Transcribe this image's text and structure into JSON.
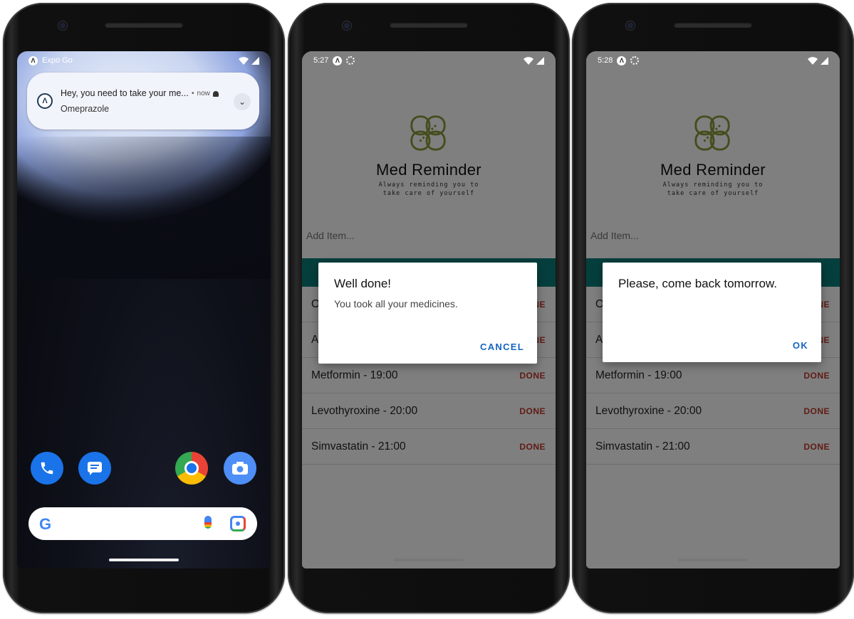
{
  "phone1": {
    "status": {
      "app_name": "Expo Go"
    },
    "notification": {
      "title": "Hey, you need to take your me...",
      "time": "now",
      "body": "Omeprazole"
    },
    "dock": {
      "apps": [
        "phone-icon",
        "messages-icon",
        "chrome-icon",
        "camera-icon"
      ]
    },
    "search": {
      "logo": "G"
    }
  },
  "phone2": {
    "status": {
      "time": "5:27"
    },
    "app": {
      "title": "Med Reminder",
      "tagline_line1": "Always reminding you to",
      "tagline_line2": "take care of yourself",
      "add_placeholder": "Add Item..."
    },
    "items": [
      {
        "label": "O",
        "action": "DONE"
      },
      {
        "label": "A",
        "action": "DONE"
      },
      {
        "label": "Metformin - 19:00",
        "action": "DONE"
      },
      {
        "label": "Levothyroxine - 20:00",
        "action": "DONE"
      },
      {
        "label": "Simvastatin - 21:00",
        "action": "DONE"
      }
    ],
    "dialog": {
      "title": "Well done!",
      "message": "You took all your medicines.",
      "button": "CANCEL"
    }
  },
  "phone3": {
    "status": {
      "time": "5:28"
    },
    "app": {
      "title": "Med Reminder",
      "tagline_line1": "Always reminding you to",
      "tagline_line2": "take care of yourself",
      "add_placeholder": "Add Item..."
    },
    "items": [
      {
        "label": "O",
        "action": "DONE"
      },
      {
        "label": "A",
        "action": "DONE"
      },
      {
        "label": "Metformin - 19:00",
        "action": "DONE"
      },
      {
        "label": "Levothyroxine - 20:00",
        "action": "DONE"
      },
      {
        "label": "Simvastatin - 21:00",
        "action": "DONE"
      }
    ],
    "dialog": {
      "message": "Please, come back tomorrow.",
      "button": "OK"
    }
  },
  "colors": {
    "accent_teal": "#0a7f7a",
    "done_red": "#c0392b",
    "dialog_button_blue": "#1565c0",
    "logo_olive": "#8a9a3a"
  }
}
